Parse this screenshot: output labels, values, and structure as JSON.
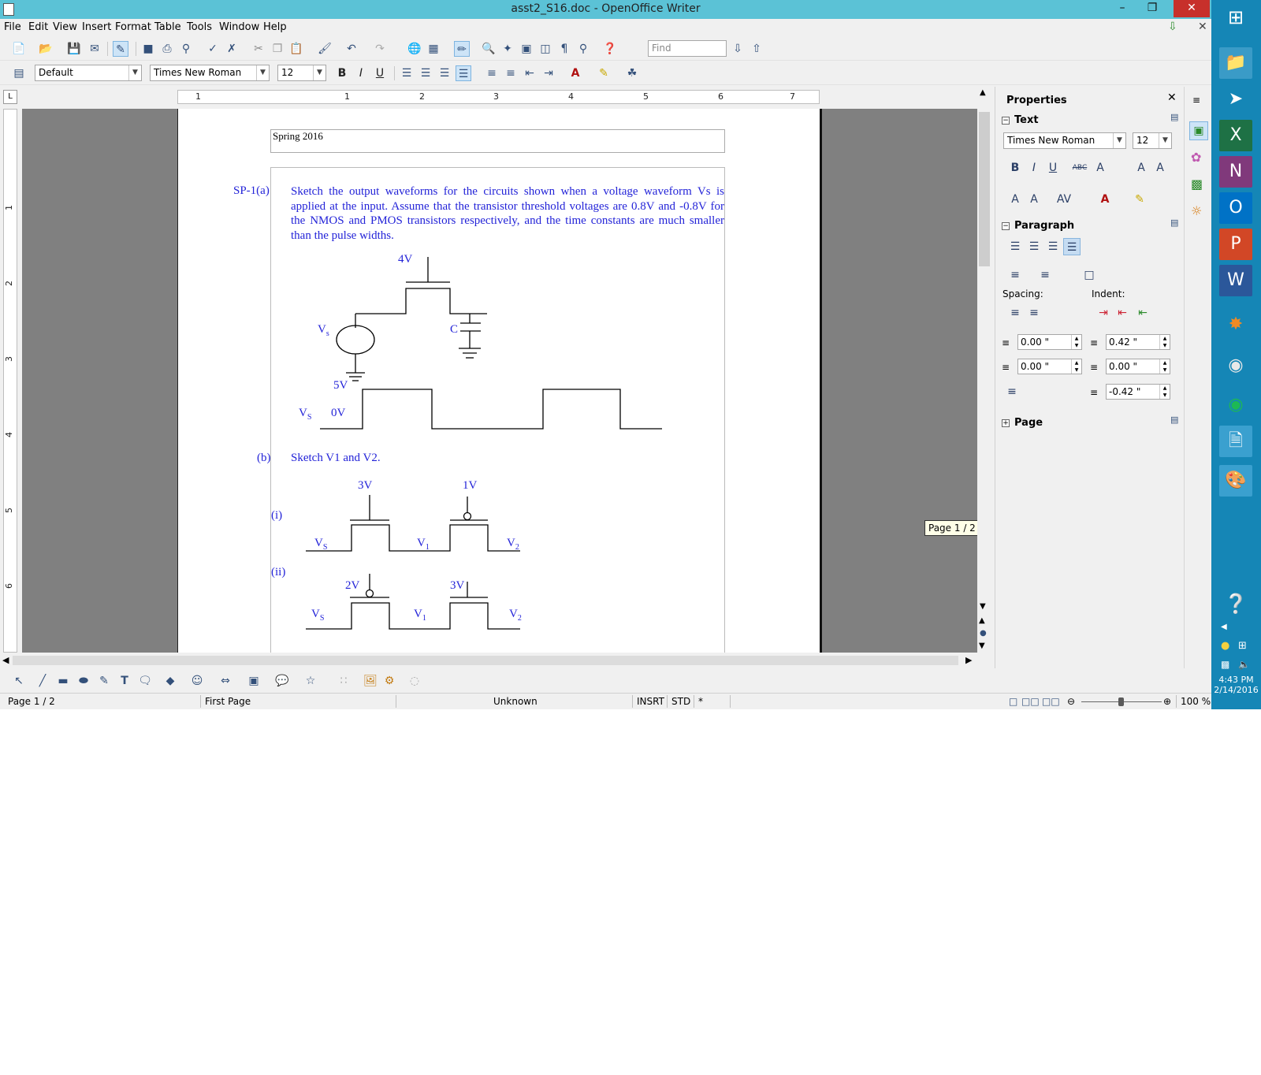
{
  "window": {
    "title": "asst2_S16.doc - OpenOffice Writer"
  },
  "menu": [
    "File",
    "Edit",
    "View",
    "Insert",
    "Format",
    "Table",
    "Tools",
    "Window",
    "Help"
  ],
  "toolbar": {
    "find_placeholder": "Find",
    "paragraph_style": "Default",
    "font_name": "Times New Roman",
    "font_size": "12",
    "bold": "B",
    "italic": "I",
    "underline": "U"
  },
  "ruler": {
    "h_numbers": [
      "1",
      "1",
      "2",
      "3",
      "4",
      "5",
      "6",
      "7"
    ],
    "v_numbers": [
      "1",
      "2",
      "3",
      "4",
      "5",
      "6"
    ]
  },
  "document": {
    "header": "Spring 2016",
    "question_label": "SP-1(a)",
    "question_text": "Sketch the output waveforms for the circuits shown when a voltage waveform Vs is applied at the input. Assume that the transistor threshold voltages are 0.8V and -0.8V for the NMOS and PMOS transistors respectively, and the time constants are much smaller than the pulse widths.",
    "circuit_a": {
      "gate_voltage": "4V",
      "source": "Vs",
      "source_sub": "s",
      "cap": "C",
      "pulse_high": "5V",
      "pulse_low": "0V",
      "waveform_label": "Vs",
      "waveform_sub": "S"
    },
    "part_b_label": "(b)",
    "part_b_text": "Sketch V1 and V2.",
    "sub_i": "(i)",
    "sub_ii": "(ii)",
    "circuit_i": {
      "g1": "3V",
      "g2": "1V",
      "n0": "V",
      "n0_sub": "S",
      "n1": "V",
      "n1_sub": "1",
      "n2": "V",
      "n2_sub": "2"
    },
    "circuit_ii": {
      "g1": "2V",
      "g2": "3V",
      "n0": "V",
      "n0_sub": "S",
      "n1": "V",
      "n1_sub": "1",
      "n2": "V",
      "n2_sub": "2"
    }
  },
  "tooltip": "Page 1 / 2",
  "sidebar": {
    "title": "Properties",
    "text_section": "Text",
    "font_name": "Times New Roman",
    "font_size": "12",
    "paragraph_section": "Paragraph",
    "spacing_label": "Spacing:",
    "indent_label": "Indent:",
    "spacing_above": "0.00 \"",
    "spacing_below": "0.00 \"",
    "indent_before": "0.42 \"",
    "indent_after": "0.00 \"",
    "first_line": "-0.42 \"",
    "page_section": "Page"
  },
  "status": {
    "page": "Page 1 / 2",
    "style": "First Page",
    "language": "Unknown",
    "insert": "INSRT",
    "selection": "STD",
    "modified": "*",
    "zoom": "100 %"
  },
  "taskbar": {
    "time": "4:43 PM",
    "date": "2/14/2016"
  },
  "colors": {
    "titlebar": "#5bc2d6",
    "taskbar": "#1586b6",
    "doc_text": "#2323d8",
    "close": "#c7302b"
  }
}
